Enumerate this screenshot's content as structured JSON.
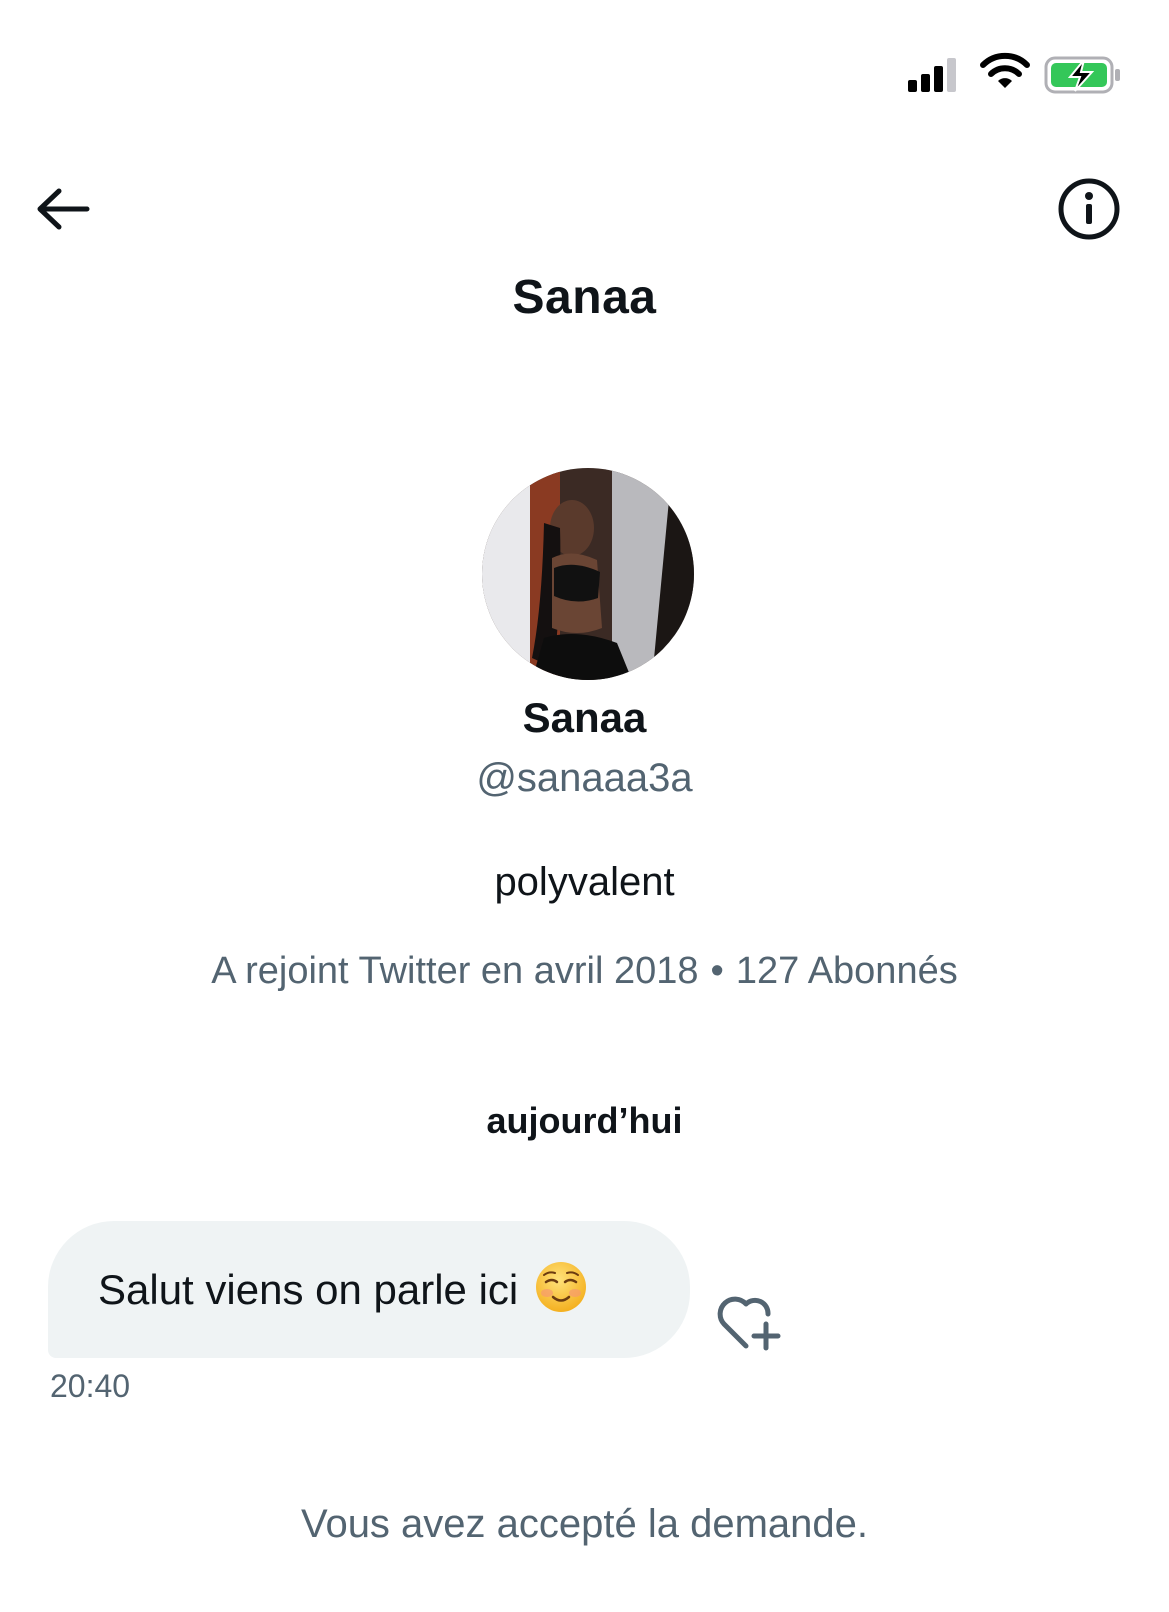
{
  "status_bar": {
    "signal_icon": "cellular-signal-icon",
    "wifi_icon": "wifi-icon",
    "battery_icon": "battery-charging-icon",
    "battery_color": "#34c759"
  },
  "header": {
    "title": "Sanaa",
    "back_icon": "arrow-left-icon",
    "info_icon": "info-circle-icon"
  },
  "profile": {
    "name": "Sanaa",
    "handle": "@sanaaa3a",
    "bio": "polyvalent",
    "joined": "A rejoint Twitter en avril 2018",
    "separator": "•",
    "followers": "127 Abonnés"
  },
  "conversation": {
    "date_label": "aujourd’hui",
    "messages": [
      {
        "text": "Salut viens on parle ici",
        "emoji": "smiling-face-icon",
        "time": "20:40",
        "reaction_icon": "heart-plus-icon"
      }
    ],
    "accepted_notice": "Vous avez accepté la demande."
  },
  "colors": {
    "text_primary": "#0f1419",
    "text_secondary": "#536471",
    "bubble_bg": "#eff3f4"
  }
}
